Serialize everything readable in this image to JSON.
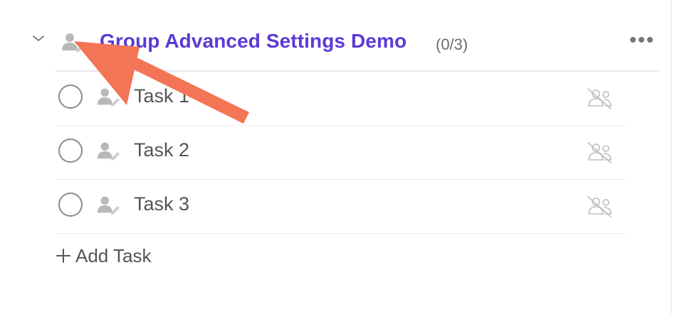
{
  "group": {
    "title": "Group Advanced Settings Demo",
    "count": "(0/3)",
    "collapse_icon": "chevron-down-icon",
    "assignee_icon": "person-edit-icon",
    "more_icon": "more-horizontal-icon"
  },
  "tasks": [
    {
      "label": "Task 1",
      "assignee_icon": "person-edit-icon",
      "followers_icon": "no-followers-icon"
    },
    {
      "label": "Task 2",
      "assignee_icon": "person-edit-icon",
      "followers_icon": "no-followers-icon"
    },
    {
      "label": "Task 3",
      "assignee_icon": "person-edit-icon",
      "followers_icon": "no-followers-icon"
    }
  ],
  "add_task": {
    "label": "Add Task",
    "icon": "plus-icon"
  },
  "colors": {
    "accent": "#5b39d4",
    "annotation": "#f47556",
    "text": "#555555",
    "icon_muted": "#b8b8b8"
  }
}
